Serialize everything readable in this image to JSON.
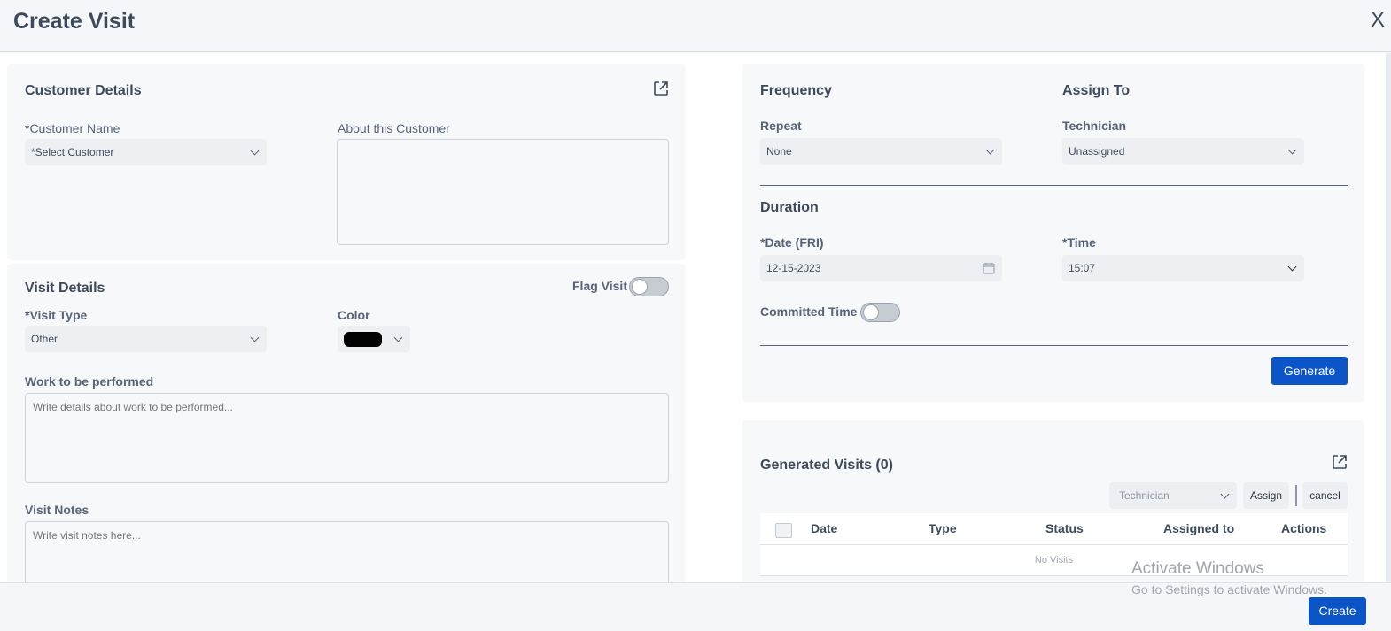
{
  "header": {
    "title": "Create Visit",
    "close_label": "X"
  },
  "customer": {
    "title": "Customer Details",
    "name_label": "*Customer Name",
    "name_value": "*Select Customer",
    "about_label": "About this Customer"
  },
  "visit": {
    "title": "Visit Details",
    "flag_label": "Flag Visit",
    "type_label": "*Visit Type",
    "type_value": "Other",
    "color_label": "Color",
    "color_value": "#000000",
    "work_label": "Work to be performed",
    "work_placeholder": "Write details about work to be performed...",
    "notes_label": "Visit Notes",
    "notes_placeholder": "Write visit notes here..."
  },
  "frequency": {
    "title": "Frequency",
    "repeat_label": "Repeat",
    "repeat_value": "None"
  },
  "assign": {
    "title": "Assign To",
    "tech_label": "Technician",
    "tech_value": "Unassigned"
  },
  "duration": {
    "title": "Duration",
    "date_label": "*Date (FRI)",
    "date_value": "12-15-2023",
    "time_label": "*Time",
    "time_value": "15:07",
    "committed_label": "Committed Time",
    "generate_label": "Generate"
  },
  "generated": {
    "title": "Generated Visits (0)",
    "tech_placeholder": "Technician",
    "assign_label": "Assign",
    "cancel_label": "cancel",
    "columns": [
      "Date",
      "Type",
      "Status",
      "Assigned to",
      "Actions"
    ],
    "empty_text": "No Visits"
  },
  "footer": {
    "create_label": "Create"
  },
  "watermark": {
    "line1": "Activate Windows",
    "line2": "Go to Settings to activate Windows."
  },
  "colors": {
    "primary": "#0b55c9",
    "text": "#3e4a5c"
  }
}
